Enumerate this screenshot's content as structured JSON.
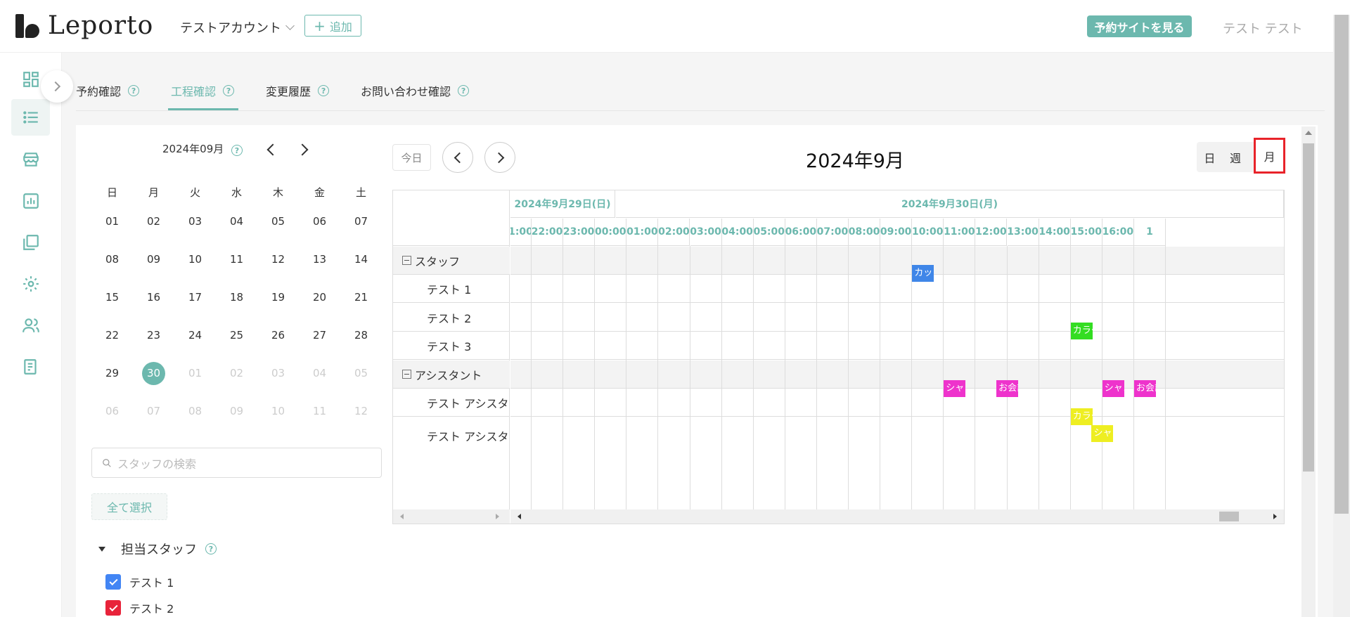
{
  "header": {
    "logo_text": "Leporto",
    "account": "テストアカウント",
    "add_label": "追加",
    "view_site": "予約サイトを見る",
    "user": "テスト テスト"
  },
  "sidebar": {
    "items": [
      {
        "icon": "dashboard-icon",
        "active": false
      },
      {
        "icon": "list-icon",
        "active": true
      },
      {
        "icon": "store-icon",
        "active": false
      },
      {
        "icon": "analytics-icon",
        "active": false
      },
      {
        "icon": "pages-icon",
        "active": false
      },
      {
        "icon": "gear-icon",
        "active": false
      },
      {
        "icon": "users-icon",
        "active": false
      },
      {
        "icon": "report-icon",
        "active": false
      }
    ]
  },
  "tabs": [
    {
      "label": "予約確認",
      "active": false
    },
    {
      "label": "工程確認",
      "active": true
    },
    {
      "label": "変更履歴",
      "active": false
    },
    {
      "label": "お問い合わせ確認",
      "active": false
    }
  ],
  "mini_calendar": {
    "title": "2024年09月",
    "dow": [
      "日",
      "月",
      "火",
      "水",
      "木",
      "金",
      "土"
    ],
    "weeks": [
      [
        "01",
        "02",
        "03",
        "04",
        "05",
        "06",
        "07"
      ],
      [
        "08",
        "09",
        "10",
        "11",
        "12",
        "13",
        "14"
      ],
      [
        "15",
        "16",
        "17",
        "18",
        "19",
        "20",
        "21"
      ],
      [
        "22",
        "23",
        "24",
        "25",
        "26",
        "27",
        "28"
      ],
      [
        "29",
        "30",
        "01",
        "02",
        "03",
        "04",
        "05"
      ],
      [
        "06",
        "07",
        "08",
        "09",
        "10",
        "11",
        "12"
      ]
    ],
    "today": "30"
  },
  "staff_search": {
    "placeholder": "スタッフの検索"
  },
  "select_all": "全て選択",
  "staff_section": {
    "title": "担当スタッフ",
    "items": [
      {
        "label": "テスト 1",
        "color": "#4285f4",
        "checked": true
      },
      {
        "label": "テスト 2",
        "color": "#e8233a",
        "checked": true
      }
    ]
  },
  "scheduler": {
    "today_label": "今日",
    "title": "2024年9月",
    "views": [
      "日",
      "週",
      "月"
    ],
    "selected_view": "月",
    "dates": [
      {
        "label": "2024年9月29日(日)"
      },
      {
        "label": "2024年9月30日(月)"
      }
    ],
    "hours": [
      "1:00",
      "22:00",
      "23:00",
      "00:00",
      "01:00",
      "02:00",
      "03:00",
      "04:00",
      "05:00",
      "06:00",
      "07:00",
      "08:00",
      "09:00",
      "10:00",
      "11:00",
      "12:00",
      "13:00",
      "14:00",
      "15:00",
      "16:00",
      "1"
    ],
    "resources": [
      {
        "label": "スタッフ",
        "group": true
      },
      {
        "label": "テスト 1",
        "group": false
      },
      {
        "label": "テスト 2",
        "group": false
      },
      {
        "label": "テスト 3",
        "group": false
      },
      {
        "label": "アシスタント",
        "group": true
      },
      {
        "label": "テスト アシスタ",
        "group": false
      },
      {
        "label": "テスト アシスタ",
        "group": false
      }
    ],
    "events": [
      {
        "label": "カット",
        "row": 1,
        "hour_index": 13,
        "color": "#3f86e8"
      },
      {
        "label": "カラー",
        "row": 3,
        "hour_index": 18,
        "color": "#33dd22"
      },
      {
        "label": "シャンプー",
        "row": 5,
        "hour_index": 14,
        "color": "#ee33cc"
      },
      {
        "label": "お会計",
        "row": 5,
        "hour_index": 15.66,
        "color": "#ee33cc"
      },
      {
        "label": "シャンプー",
        "row": 5,
        "hour_index": 19,
        "color": "#ee33cc"
      },
      {
        "label": "お会計",
        "row": 5,
        "hour_index": 20,
        "color": "#ee33cc"
      },
      {
        "label": "カラー",
        "row": 6,
        "hour_index": 18,
        "color": "#eeee22",
        "lane": 0
      },
      {
        "label": "シャンプー",
        "row": 6,
        "hour_index": 18.66,
        "color": "#eeee22",
        "lane": 1
      }
    ]
  }
}
